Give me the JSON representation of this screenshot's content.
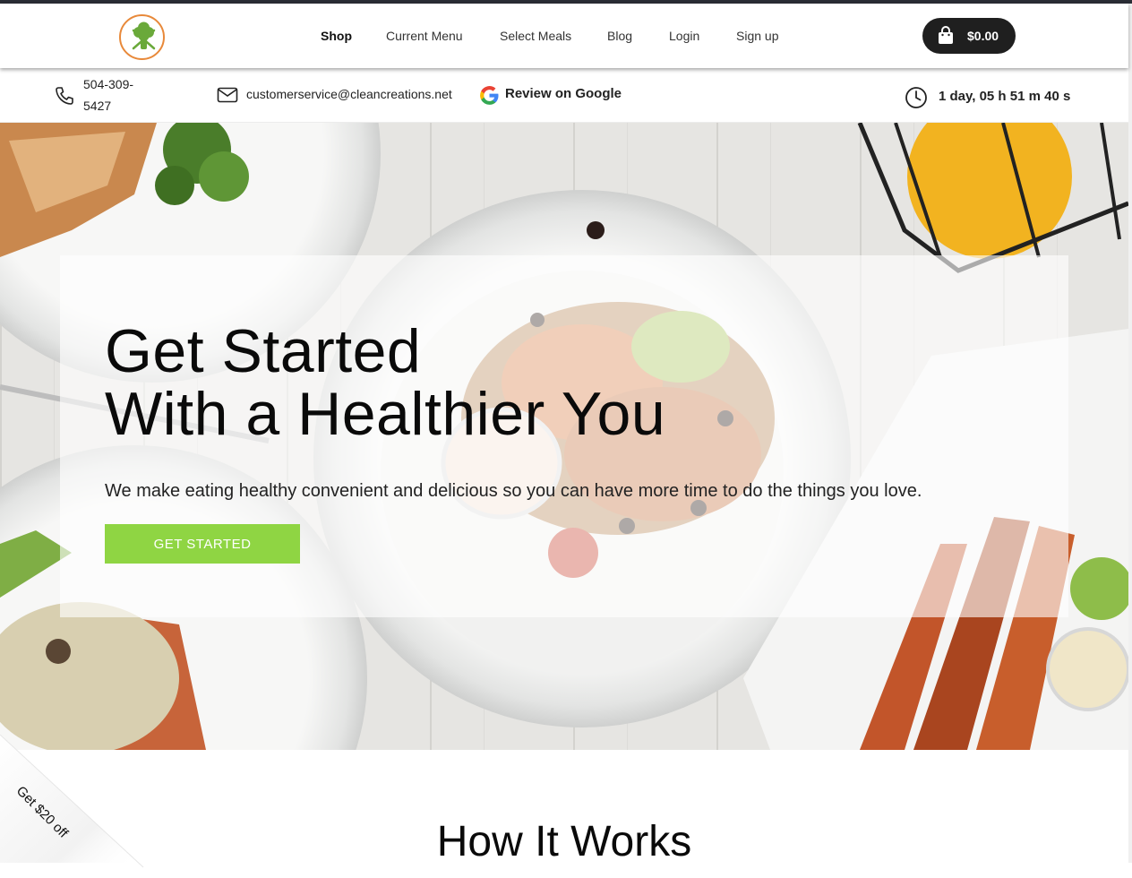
{
  "nav": {
    "logo_icon": "broccoli-chef-logo",
    "links": [
      "Shop",
      "Current Menu",
      "Select Meals",
      "Blog",
      "Login",
      "Sign up"
    ],
    "active": "Shop",
    "cart_total": "$0.00",
    "cart_icon": "shopping-bag-icon"
  },
  "info": {
    "phone": "504-309-5427",
    "email": "customerservice@cleancreations.net",
    "google_review": "Review on Google",
    "countdown": "1 day, 05 h 51 m 40 s"
  },
  "hero": {
    "title_line1": "Get Started",
    "title_line2": "With a Healthier You",
    "subtitle": "We make eating healthy convenient and delicious so you can have more time to do the things you love.",
    "cta_label": "GET STARTED"
  },
  "promo": {
    "label": "Get $20 off"
  },
  "section": {
    "title": "How It Works"
  },
  "colors": {
    "accent_green": "#8fd543",
    "logo_orange": "#e8893a",
    "dark": "#1f1f1f"
  }
}
